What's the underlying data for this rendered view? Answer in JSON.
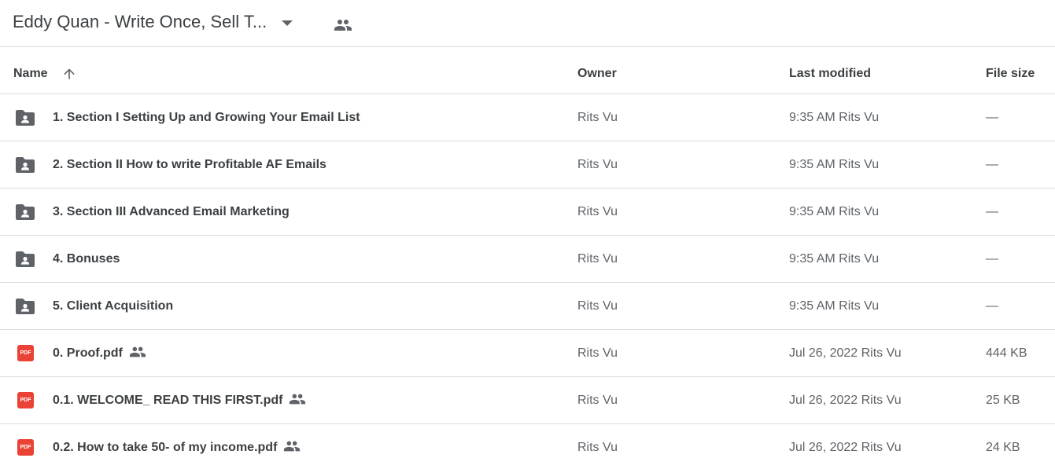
{
  "header": {
    "title": "Eddy Quan - Write Once, Sell T...",
    "dropdown_icon": "caret-down-icon",
    "shared_icon": "people-icon"
  },
  "columns": {
    "name": "Name",
    "owner": "Owner",
    "last_modified": "Last modified",
    "file_size": "File size",
    "sort_icon": "arrow-up-icon"
  },
  "files": [
    {
      "type": "folder",
      "name": "1. Section I Setting Up and Growing Your Email List",
      "shared": false,
      "owner": "Rits Vu",
      "modified": "9:35 AM  Rits Vu",
      "size": "—"
    },
    {
      "type": "folder",
      "name": "2. Section II How to write Profitable AF Emails",
      "shared": false,
      "owner": "Rits Vu",
      "modified": "9:35 AM  Rits Vu",
      "size": "—"
    },
    {
      "type": "folder",
      "name": "3. Section III Advanced Email Marketing",
      "shared": false,
      "owner": "Rits Vu",
      "modified": "9:35 AM  Rits Vu",
      "size": "—"
    },
    {
      "type": "folder",
      "name": "4. Bonuses",
      "shared": false,
      "owner": "Rits Vu",
      "modified": "9:35 AM  Rits Vu",
      "size": "—"
    },
    {
      "type": "folder",
      "name": "5. Client Acquisition",
      "shared": false,
      "owner": "Rits Vu",
      "modified": "9:35 AM  Rits Vu",
      "size": "—"
    },
    {
      "type": "pdf",
      "name": "0. Proof.pdf",
      "shared": true,
      "owner": "Rits Vu",
      "modified": "Jul 26, 2022  Rits Vu",
      "size": "444 KB"
    },
    {
      "type": "pdf",
      "name": "0.1. WELCOME_ READ THIS FIRST.pdf",
      "shared": true,
      "owner": "Rits Vu",
      "modified": "Jul 26, 2022  Rits Vu",
      "size": "25 KB"
    },
    {
      "type": "pdf",
      "name": "0.2. How to take 50- of my income.pdf",
      "shared": true,
      "owner": "Rits Vu",
      "modified": "Jul 26, 2022  Rits Vu",
      "size": "24 KB"
    }
  ],
  "pdf_badge": "PDF",
  "colors": {
    "text": "#3c4043",
    "secondary": "#5f6368",
    "divider": "#dadce0",
    "pdf_red": "#ea4335"
  }
}
